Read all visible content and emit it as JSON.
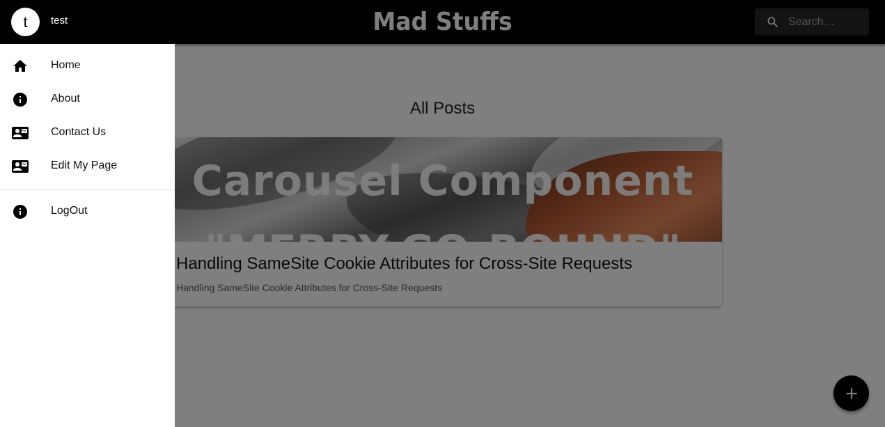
{
  "header": {
    "title": "Mad Stuffs",
    "search": {
      "placeholder": "Search…",
      "value": ""
    }
  },
  "main": {
    "heading": "All Posts",
    "posts": [
      {
        "image_title": "Carousel Component",
        "image_subtitle": "\"MERRY-GO-ROUND\"",
        "title": "Handling SameSite Cookie Attributes for Cross-Site Requests",
        "excerpt": "Handling SameSite Cookie Attributes for Cross-Site Requests"
      }
    ],
    "fab": {
      "icon": "plus-icon"
    }
  },
  "drawer": {
    "user": {
      "initial": "t",
      "name": "test"
    },
    "items": [
      {
        "label": "Home",
        "icon": "home-icon"
      },
      {
        "label": "About",
        "icon": "info-icon"
      },
      {
        "label": "Contact Us",
        "icon": "contact-card-icon"
      },
      {
        "label": "Edit My Page",
        "icon": "contact-card-icon"
      }
    ],
    "secondary_items": [
      {
        "label": "LogOut",
        "icon": "info-icon"
      }
    ]
  },
  "colors": {
    "app_bar": "#000000",
    "drawer": "#ffffff",
    "backdrop": "rgba(0,0,0,0.5)",
    "fab": "#000000"
  }
}
